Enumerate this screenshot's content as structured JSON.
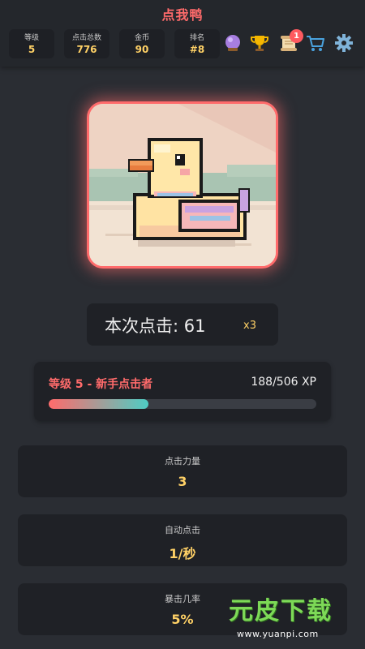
{
  "header": {
    "title": "点我鸭",
    "stats": [
      {
        "label": "等级",
        "value": "5"
      },
      {
        "label": "点击总数",
        "value": "776"
      },
      {
        "label": "金币",
        "value": "90"
      },
      {
        "label": "排名",
        "value": "#8"
      }
    ],
    "icons": [
      {
        "name": "crystal-ball-icon",
        "glyph": "🔮"
      },
      {
        "name": "trophy-icon",
        "glyph": "🏆"
      },
      {
        "name": "scroll-icon",
        "glyph": "📜"
      },
      {
        "name": "cart-icon",
        "glyph": "🛒"
      },
      {
        "name": "gear-icon",
        "glyph": "⚙"
      }
    ],
    "notification_count": "1"
  },
  "duck": {
    "image": "pixel-duck-icon",
    "border_color": "#ff6b6b"
  },
  "click": {
    "label": "本次点击: 61",
    "multiplier": "x3"
  },
  "level": {
    "title": "等级 5 - 新手点击者",
    "xp": "188/506 XP",
    "progress_fraction": 0.372
  },
  "upgrades": [
    {
      "label": "点击力量",
      "value": "3"
    },
    {
      "label": "自动点击",
      "value": "1/秒"
    },
    {
      "label": "暴击几率",
      "value": "5%"
    }
  ],
  "watermark": {
    "logo": "元皮下载",
    "url": "www.yuanpi.com"
  },
  "colors": {
    "accent": "#ff6b6b",
    "gold": "#ffd166",
    "teal": "#4ecdc4",
    "background": "#2a2d33"
  }
}
